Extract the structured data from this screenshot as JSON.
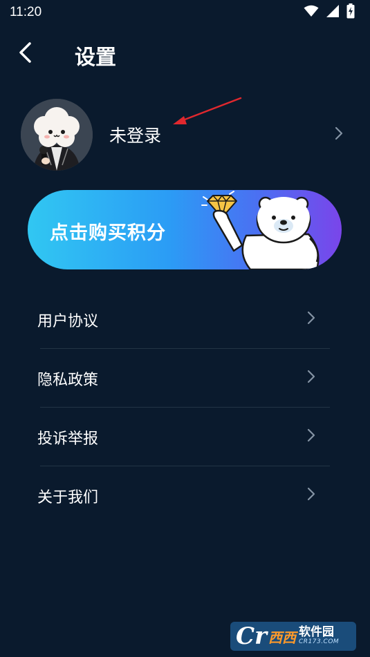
{
  "status_bar": {
    "time": "11:20",
    "icons": [
      "wifi-icon",
      "signal-icon",
      "battery-charging-icon"
    ]
  },
  "header": {
    "back_icon": "chevron-left-icon",
    "title": "设置"
  },
  "profile": {
    "name": "未登录",
    "avatar_icon": "cloud-character-avatar",
    "chevron_icon": "chevron-right-icon"
  },
  "banner": {
    "label": "点击购买积分",
    "gradient_start": "#31c7f2",
    "gradient_end": "#7a45ea",
    "illustration": "polar-bear-holding-diamond"
  },
  "menu": {
    "items": [
      {
        "label": "用户协议"
      },
      {
        "label": "隐私政策"
      },
      {
        "label": "投诉举报"
      },
      {
        "label": "关于我们"
      }
    ]
  },
  "colors": {
    "background": "#0a1a2d",
    "divider": "#233445",
    "annotation_arrow": "#e0282e"
  },
  "watermark": {
    "letter": "Cr",
    "mid": "西西",
    "main": "软件园",
    "sub": "CR173.COM"
  }
}
